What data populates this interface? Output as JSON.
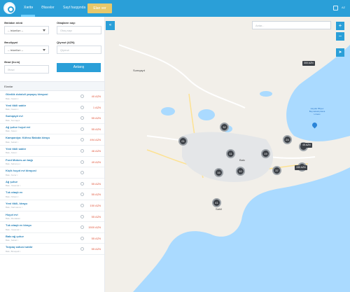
{
  "topbar": {
    "nav": [
      "Xəritə",
      "Əlavələr",
      "Sayt haqqında"
    ],
    "announce_label": "Elan ver",
    "lang": "AZ"
  },
  "filters": {
    "type_label": "Əmlakın növü",
    "type_value": "-- istənilən --",
    "rooms_label": "Otaqların sayı",
    "rooms_placeholder": "Otaq sayı",
    "deal_label": "Əməliyyat",
    "deal_value": "-- istənilən --",
    "price_label": "Qiymət (AZN)",
    "price_placeholder": "Qiymət",
    "area_label": "Ərazi (kv.m)",
    "area_placeholder": "Ərazi",
    "search_label": "Axtarış"
  },
  "list": {
    "header": "Elanlar",
    "items": [
      {
        "title": "Günlük dəbdəli yaşayış kirayəsi",
        "sub": "Bakı, Nəsimi r.",
        "price": "40 AZN"
      },
      {
        "title": "Yeni tikili satılır",
        "sub": "Bakı, Nəsimi r.",
        "price": "1 AZN"
      },
      {
        "title": "Sumqayıt evi",
        "sub": "Bakı, Sumqayıt",
        "price": "55 AZN"
      },
      {
        "title": "Ağ şəhər həyət evi",
        "sub": "Bakı, Xətai r.",
        "price": "55 AZN"
      },
      {
        "title": "Kampaniya: Köhnə Bakıda kirayə",
        "sub": "Bakı, Səbail r.",
        "price": "494 AZN"
      },
      {
        "title": "Yeni tikili satılır",
        "sub": "Bakı, Xətai r.",
        "price": "46 AZN"
      },
      {
        "title": "Ford Motors-un bağı",
        "sub": "Bakı, Sabunçu r.",
        "price": "49 AZN"
      },
      {
        "title": "Kiçik həyət evi kirayəsi",
        "sub": "Bakı, Xəzər r.",
        "price": ""
      },
      {
        "title": "Ağ şəhər",
        "sub": "Bakı, Yasamal r.",
        "price": "55 AZN"
      },
      {
        "title": "Tək otaqlı ev",
        "sub": "Bakı, Nizami r.",
        "price": "55 AZN"
      },
      {
        "title": "Yeni tikili, kirayə",
        "sub": "Bakı, Nərimanov r.",
        "price": "150 AZN"
      },
      {
        "title": "Həyət evi",
        "sub": "Bakı, Mərdəkan",
        "price": "55 AZN"
      },
      {
        "title": "Tək otaqlı ev kirayə",
        "sub": "Bakı, Yasamal r.",
        "price": "1500 AZN"
      },
      {
        "title": "Bakı ağ şəhər",
        "sub": "Bakı, Səbail r.",
        "price": "55 AZN"
      },
      {
        "title": "Torpaq sahəsi satılır",
        "sub": "Bakı, Binəqədi r.",
        "price": "55 AZN"
      }
    ]
  },
  "map": {
    "search_placeholder": "Axtar...",
    "collapse_label": "«",
    "zoom_in": "+",
    "zoom_out": "−",
    "labels": {
      "sumqayit": "Sumqayıt",
      "baki": "Bakı",
      "sahil": "Sahil"
    },
    "poi_label": "Heydər Əliyev Beynəlxalq Hava Limanı",
    "clusters": [
      {
        "label": "21"
      },
      {
        "label": "32"
      },
      {
        "label": "11"
      },
      {
        "label": "19"
      },
      {
        "label": "24"
      },
      {
        "label": "16"
      },
      {
        "label": "10"
      },
      {
        "label": "37"
      },
      {
        "label": "41"
      },
      {
        "label": "25"
      },
      {
        "label": "4"
      }
    ],
    "prices": [
      "300 AZN",
      "45 AZN",
      "150 AZN"
    ],
    "colors": {
      "water": "#aadaff",
      "land": "#f2efe9",
      "accent": "#2a9fd8"
    }
  }
}
